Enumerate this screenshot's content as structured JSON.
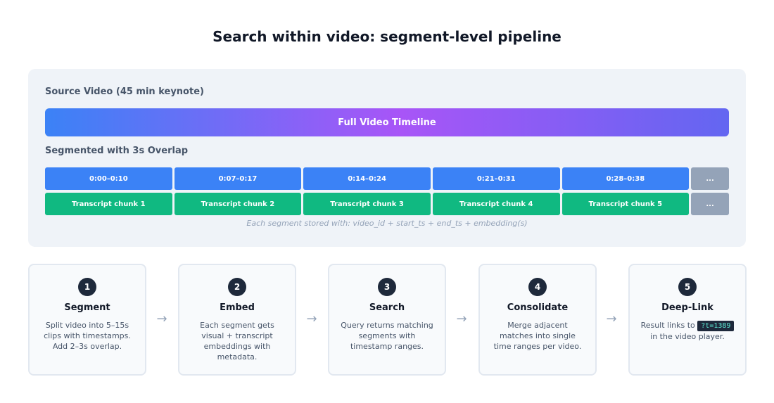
{
  "title": "Search within video: segment-level pipeline",
  "source_panel": {
    "label": "Source Video (45 min keynote)",
    "timeline_label": "Full Video Timeline",
    "segmented_label": "Segmented with 3s Overlap",
    "segments": [
      "0:00–0:10",
      "0:07–0:17",
      "0:14–0:24",
      "0:21–0:31",
      "0:28–0:38",
      "..."
    ],
    "chunks": [
      "Transcript chunk 1",
      "Transcript chunk 2",
      "Transcript chunk 3",
      "Transcript chunk 4",
      "Transcript chunk 5",
      "..."
    ],
    "note": "Each segment stored with: video_id + start_ts + end_ts + embedding(s)"
  },
  "steps": [
    {
      "number": "1",
      "title": "Segment",
      "desc": "Split video into 5–15s clips with timestamps. Add 2–3s overlap."
    },
    {
      "number": "2",
      "title": "Embed",
      "desc": "Each segment gets visual + transcript embeddings with metadata."
    },
    {
      "number": "3",
      "title": "Search",
      "desc": "Query returns matching segments with timestamp ranges."
    },
    {
      "number": "4",
      "title": "Consolidate",
      "desc": "Merge adjacent matches into single time ranges per video."
    },
    {
      "number": "5",
      "title": "Deep-Link",
      "desc_before": "Result links to",
      "code": "?t=1389",
      "desc_after": "in the video player."
    }
  ],
  "arrow_glyph": "→",
  "colors": {
    "segment_blue": "#3b82f6",
    "chunk_green": "#10b981",
    "more_gray": "#94a3b8",
    "gradient": [
      "#3b82f6",
      "#a855f7",
      "#6366f1"
    ]
  }
}
